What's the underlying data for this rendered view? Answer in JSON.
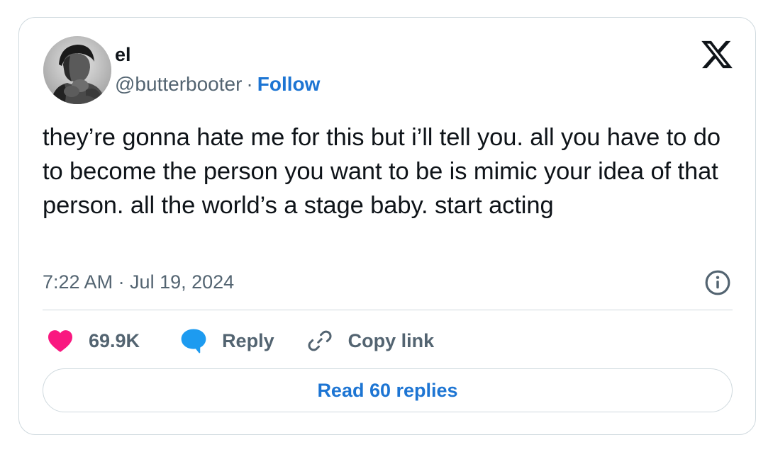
{
  "author": {
    "name": "el",
    "handle": "@butterbooter",
    "separator": "·",
    "follow_label": "Follow"
  },
  "tweet": {
    "text": "they’re gonna hate me for this but i’ll tell you. all you have to do to become the person you want to be is mimic your idea of that person. all the world’s a stage baby. start acting",
    "timestamp": "7:22 AM · Jul 19, 2024"
  },
  "actions": {
    "like_count": "69.9K",
    "reply_label": "Reply",
    "copy_link_label": "Copy link"
  },
  "read_replies_label": "Read 60 replies",
  "icons": {
    "logo": "x-logo-icon",
    "info": "info-icon",
    "like": "heart-icon",
    "reply": "speech-bubble-icon",
    "copy": "link-icon"
  },
  "colors": {
    "accent": "#1d75d3",
    "like": "#f91880",
    "reply": "#1d9bf0",
    "muted": "#536471",
    "border": "#cfd9de"
  }
}
